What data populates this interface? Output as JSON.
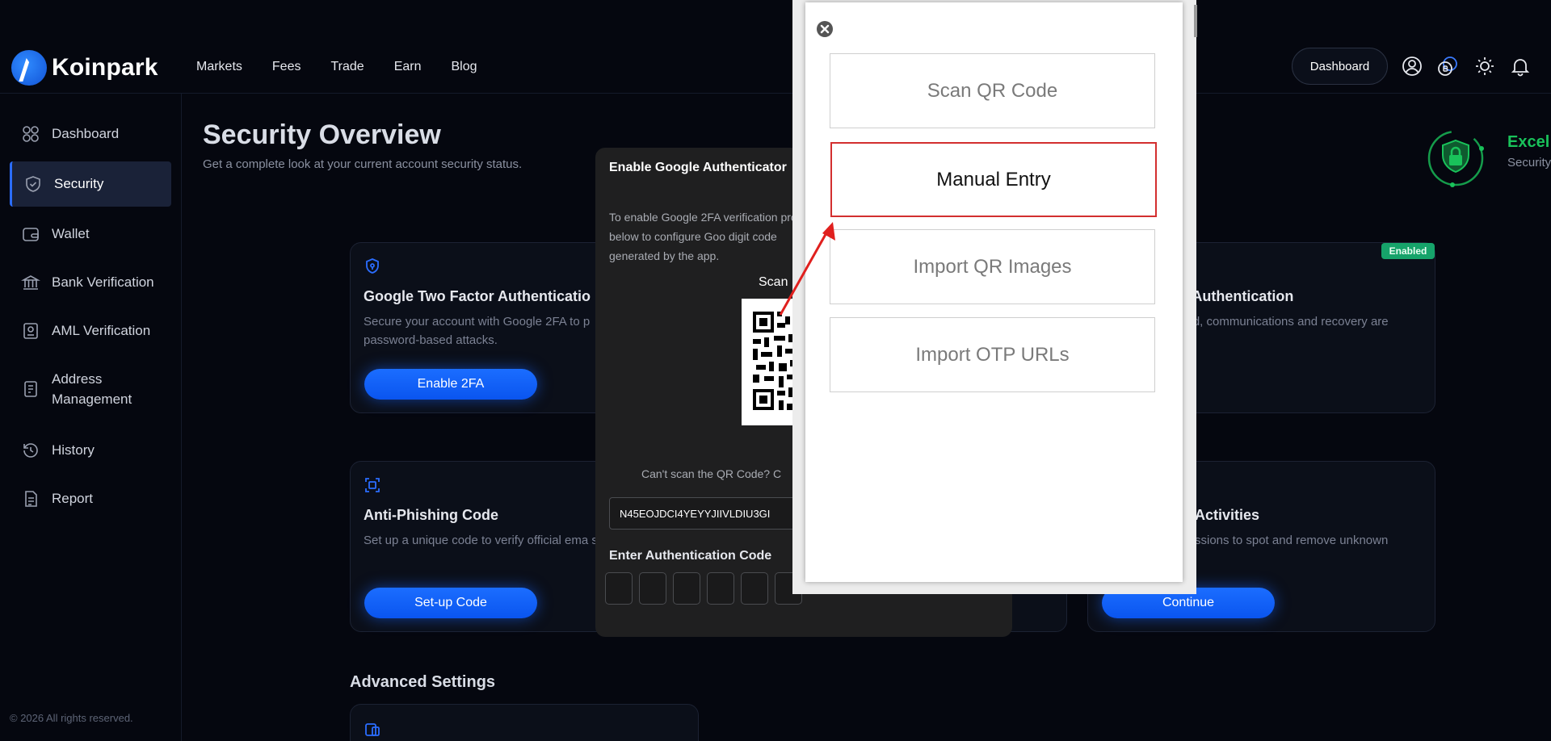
{
  "brand": {
    "name": "Koinpark"
  },
  "nav": [
    "Markets",
    "Fees",
    "Trade",
    "Earn",
    "Blog"
  ],
  "header": {
    "dashboard_label": "Dashboard"
  },
  "sidebar": {
    "items": [
      {
        "label": "Dashboard"
      },
      {
        "label": "Security"
      },
      {
        "label": "Wallet"
      },
      {
        "label": "Bank Verification"
      },
      {
        "label": "AML Verification"
      },
      {
        "label": "Address Management"
      },
      {
        "label": "History"
      },
      {
        "label": "Report"
      }
    ],
    "copyright": "© 2026 All rights reserved."
  },
  "page": {
    "title": "Security Overview",
    "subtitle": "Get a complete look at your current account security status.",
    "status_title": "Excel",
    "status_sub": "Security"
  },
  "cards": {
    "google": {
      "title": "Google Two Factor Authenticatio",
      "desc": "Secure your account with Google 2FA to p password-based attacks.",
      "button": "Enable 2FA"
    },
    "passkey": {
      "title": "s Authentication",
      "desc": "fied, communications and recovery are",
      "badge": "Enabled"
    },
    "antiphish": {
      "title": "Anti-Phishing Code",
      "desc": "Set up a unique code to verify official ema scams.",
      "button": "Set-up Code"
    },
    "activities": {
      "title": "Activities",
      "desc": "ssions to spot and remove unknown",
      "button": "Continue"
    }
  },
  "advanced": {
    "title": "Advanced Settings"
  },
  "modal": {
    "title": "Enable Google Authenticator",
    "desc": "To enable Google 2FA verification provided below to configure Goo digit code generated by the app.",
    "scan_label": "Scan",
    "cant_scan": "Can't scan the QR Code? C",
    "secret_key": "N45EOJDCI4YEYYJIIVLDIU3GI",
    "enter_code_label": "Enter Authentication Code",
    "otp_boxes": 6
  },
  "popup": {
    "options": [
      {
        "label": "Scan QR Code",
        "selected": false
      },
      {
        "label": "Manual Entry",
        "selected": true
      },
      {
        "label": "Import QR Images",
        "selected": false
      },
      {
        "label": "Import OTP URLs",
        "selected": false
      }
    ]
  },
  "colors": {
    "accent_blue": "#1b6dff",
    "status_green": "#19c25a",
    "selection_red": "#d32f2f"
  }
}
